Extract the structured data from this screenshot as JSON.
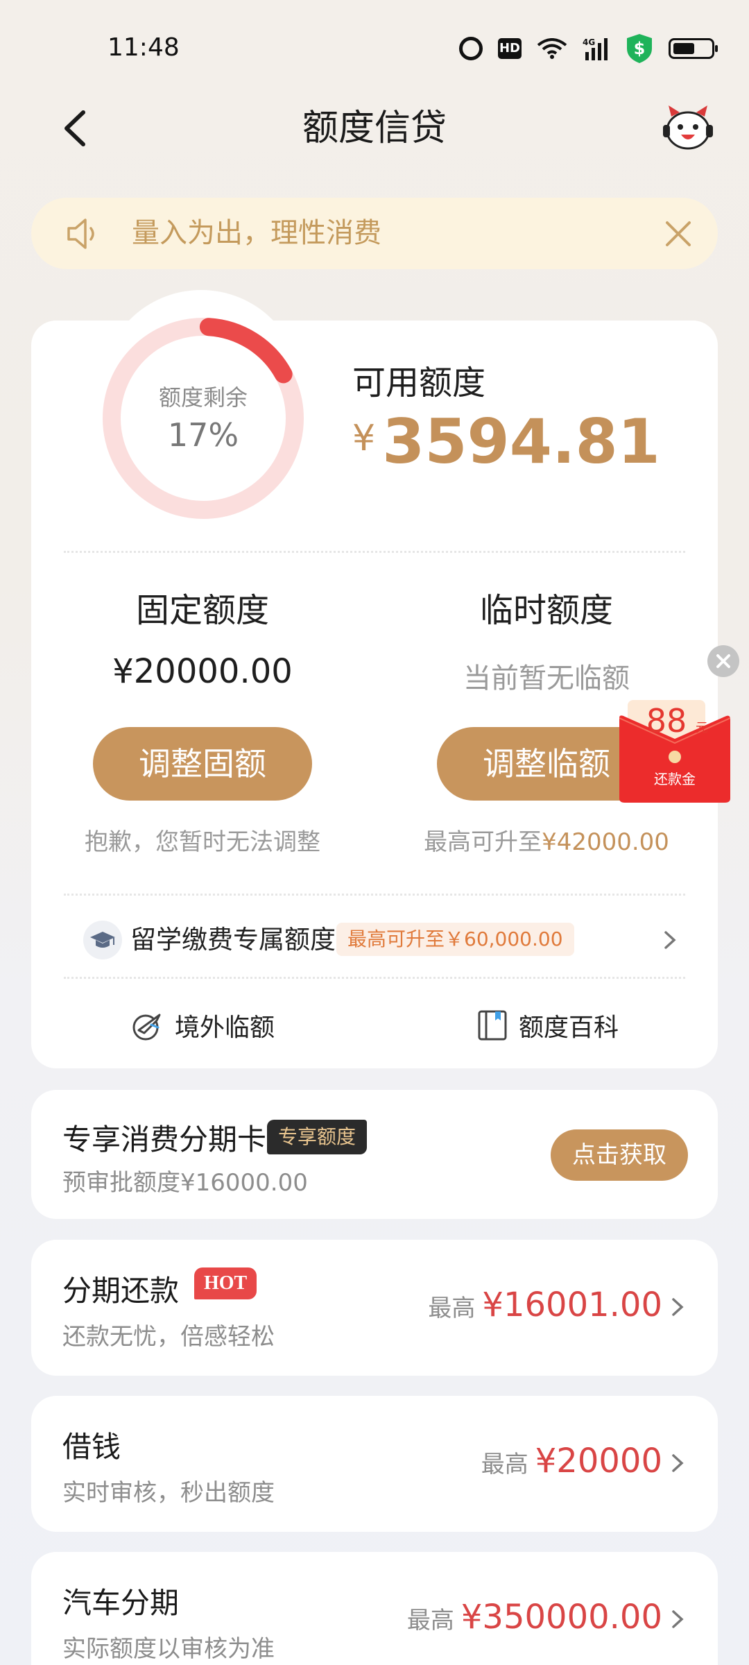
{
  "status_bar": {
    "time": "11:48",
    "icons": [
      "alarm-icon",
      "hd-icon",
      "wifi-icon",
      "signal-4g-icon",
      "security-shield-icon",
      "battery-icon"
    ],
    "hd_label": "HD"
  },
  "header": {
    "title": "额度信贷",
    "back_icon": "chevron-left-icon",
    "mascot_icon": "mascot-avatar-icon"
  },
  "notice": {
    "text": "量入为出，理性消费",
    "icon": "speaker-icon",
    "close_icon": "close-icon"
  },
  "credit": {
    "ring_label": "额度剩余",
    "ring_percent_text": "17%",
    "ring_fraction": 0.17,
    "available_label": "可用额度",
    "currency_symbol": "¥",
    "available_amount": "3594.81",
    "fixed": {
      "title": "固定额度",
      "value": "¥20000.00",
      "button": "调整固额",
      "note": "抱歉，您暂时无法调整"
    },
    "temporary": {
      "title": "临时额度",
      "value": "当前暂无临额",
      "button": "调整临额",
      "note_prefix": "最高可升至",
      "note_value": "¥42000.00"
    },
    "study": {
      "text": "留学缴费专属额度",
      "badge": "最高可升至￥60,000.00"
    },
    "links": [
      {
        "label": "境外临额",
        "icon": "airplane-globe-icon"
      },
      {
        "label": "额度百科",
        "icon": "book-icon"
      }
    ]
  },
  "coupon": {
    "amount": "88",
    "unit": "元",
    "label": "还款金"
  },
  "cards": [
    {
      "title": "专享消费分期卡",
      "tag": "专享额度",
      "subtitle": "预审批额度¥16000.00",
      "button": "点击获取"
    },
    {
      "title": "分期还款",
      "tag": "HOT",
      "subtitle": "还款无忧，倍感轻松",
      "max_label": "最高",
      "max_value": "¥16001.00"
    },
    {
      "title": "借钱",
      "subtitle": "实时审核，秒出额度",
      "max_label": "最高",
      "max_value": "¥20000"
    },
    {
      "title": "汽车分期",
      "subtitle": "实际额度以审核为准",
      "max_label": "最高",
      "max_value": "¥350000.00"
    }
  ],
  "colors": {
    "gold": "#c8955d",
    "gold_text": "#c4915a",
    "red": "#d94545",
    "notice_bg": "#fcf3df",
    "ring_track": "#fbdedd",
    "ring_fill": "#eb4b4b"
  }
}
